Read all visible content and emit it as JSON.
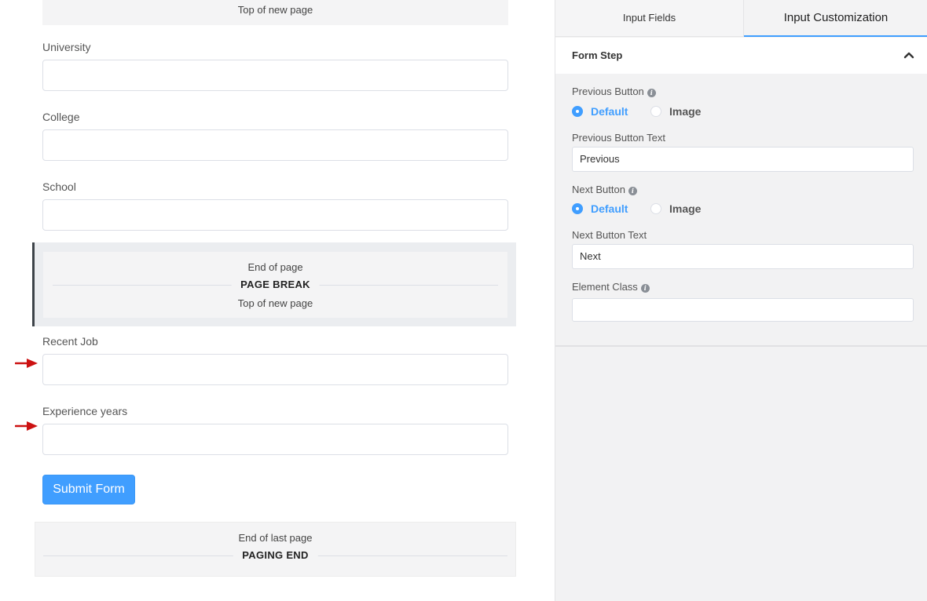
{
  "canvas": {
    "top_break": {
      "top_of_new_page": "Top of new page"
    },
    "fields": [
      {
        "label": "University",
        "value": ""
      },
      {
        "label": "College",
        "value": ""
      },
      {
        "label": "School",
        "value": ""
      },
      {
        "label": "Recent Job",
        "value": ""
      },
      {
        "label": "Experience years",
        "value": ""
      }
    ],
    "page_break": {
      "end_of_page": "End of page",
      "title": "PAGE BREAK",
      "top_of_new_page": "Top of new page"
    },
    "submit_label": "Submit Form",
    "paging_end": {
      "end_of_last_page": "End of last page",
      "title": "PAGING END"
    },
    "arrow_color": "#cc1111"
  },
  "panel": {
    "tabs": [
      {
        "label": "Input Fields",
        "active": false
      },
      {
        "label": "Input Customization",
        "active": true
      }
    ],
    "section": {
      "title": "Form Step",
      "expanded": true,
      "previous_button": {
        "label": "Previous Button",
        "options": [
          "Default",
          "Image"
        ],
        "selected": "Default"
      },
      "previous_button_text": {
        "label": "Previous Button Text",
        "value": "Previous"
      },
      "next_button": {
        "label": "Next Button",
        "options": [
          "Default",
          "Image"
        ],
        "selected": "Default"
      },
      "next_button_text": {
        "label": "Next Button Text",
        "value": "Next"
      },
      "element_class": {
        "label": "Element Class",
        "value": ""
      }
    }
  },
  "colors": {
    "accent": "#409eff",
    "panel_bg": "#f2f2f3"
  }
}
